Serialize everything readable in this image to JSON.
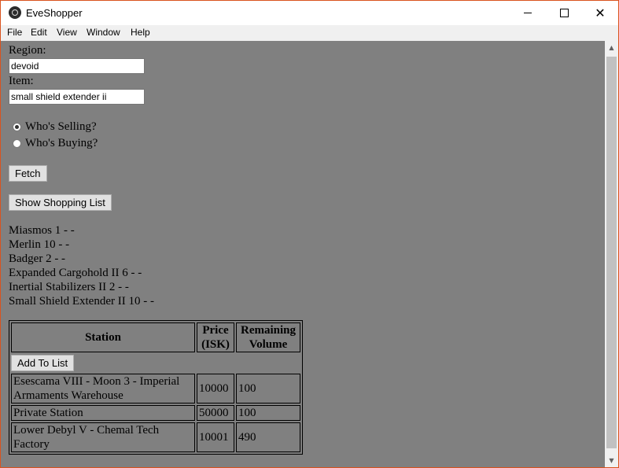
{
  "window": {
    "title": "EveShopper",
    "minimize_glyph": "",
    "close_glyph": "✕"
  },
  "menu": {
    "items": [
      "File",
      "Edit",
      "View",
      "Window",
      "Help"
    ]
  },
  "form": {
    "region_label": "Region:",
    "region_value": "devoid",
    "item_label": "Item:",
    "item_value": "small shield extender ii",
    "radio_selling": "Who's Selling?",
    "radio_buying": "Who's Buying?",
    "selected_mode": "selling",
    "fetch_label": "Fetch",
    "show_list_label": "Show Shopping List"
  },
  "shopping_list": [
    "Miasmos 1 - -",
    "Merlin 10 - -",
    "Badger 2 - -",
    "Expanded Cargohold II 6 - -",
    "Inertial Stabilizers II 2 - -",
    "Small Shield Extender II 10 - -"
  ],
  "results_table": {
    "headers": [
      "Station",
      "Price (ISK)",
      "Remaining Volume"
    ],
    "add_button_label": "Add To List",
    "rows": [
      {
        "station": "Esescama VIII - Moon 3 - Imperial Armaments Warehouse",
        "price": "10000",
        "volume": "100"
      },
      {
        "station": "Private Station",
        "price": "50000",
        "volume": "100"
      },
      {
        "station": "Lower Debyl V - Chemal Tech Factory",
        "price": "10001",
        "volume": "490"
      }
    ]
  },
  "colors": {
    "window_border": "#d9531e",
    "content_background": "#808080",
    "menubar_background": "#f0f0f0"
  }
}
